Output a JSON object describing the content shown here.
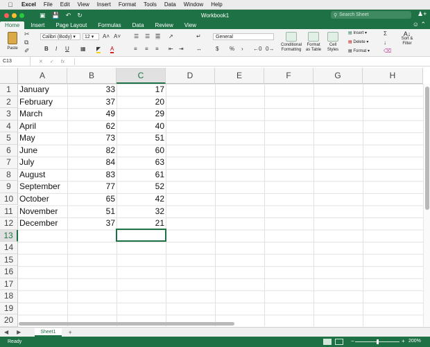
{
  "menubar": {
    "app": "Excel",
    "items": [
      "File",
      "Edit",
      "View",
      "Insert",
      "Format",
      "Tools",
      "Data",
      "Window",
      "Help"
    ]
  },
  "titlebar": {
    "title": "Workbook1",
    "search_placeholder": "Search Sheet",
    "colors": {
      "close": "#fe5f57",
      "minimize": "#febc2e",
      "zoom": "#28c840",
      "brand": "#1e7145"
    }
  },
  "ribbon": {
    "tabs": [
      "Home",
      "Insert",
      "Page Layout",
      "Formulas",
      "Data",
      "Review",
      "View"
    ],
    "active_tab": "Home",
    "paste_label": "Paste",
    "font_name": "Calibri (Body)",
    "font_size": "12",
    "number_format": "General",
    "conditional_formatting": [
      "Conditional",
      "Formatting"
    ],
    "format_as_table": [
      "Format",
      "as Table"
    ],
    "cell_styles": [
      "Cell",
      "Styles"
    ],
    "insert_label": "Insert",
    "delete_label": "Delete",
    "format_label": "Format",
    "sort_filter": [
      "Sort &",
      "Filter"
    ]
  },
  "formula_bar": {
    "name_box": "C13",
    "fx": "fx",
    "content": ""
  },
  "grid": {
    "columns": [
      "A",
      "B",
      "C",
      "D",
      "E",
      "F",
      "G",
      "H"
    ],
    "selected_column": "C",
    "row_numbers": [
      "1",
      "2",
      "3",
      "4",
      "5",
      "6",
      "7",
      "8",
      "9",
      "10",
      "11",
      "12",
      "13",
      "14",
      "15",
      "16",
      "17",
      "18",
      "19",
      "20"
    ],
    "selected_row": "13",
    "rows": [
      {
        "a": "January",
        "b": "33",
        "c": "17"
      },
      {
        "a": "February",
        "b": "37",
        "c": "20"
      },
      {
        "a": "March",
        "b": "49",
        "c": "29"
      },
      {
        "a": "April",
        "b": "62",
        "c": "40"
      },
      {
        "a": "May",
        "b": "73",
        "c": "51"
      },
      {
        "a": "June",
        "b": "82",
        "c": "60"
      },
      {
        "a": "July",
        "b": "84",
        "c": "63"
      },
      {
        "a": "August",
        "b": "83",
        "c": "61"
      },
      {
        "a": "September",
        "b": "77",
        "c": "52"
      },
      {
        "a": "October",
        "b": "65",
        "c": "42"
      },
      {
        "a": "November",
        "b": "51",
        "c": "32"
      },
      {
        "a": "December",
        "b": "37",
        "c": "21"
      }
    ]
  },
  "sheets": {
    "tabs": [
      "Sheet1"
    ],
    "active": "Sheet1",
    "add_label": "+"
  },
  "status": {
    "text": "Ready",
    "zoom": "200%"
  }
}
